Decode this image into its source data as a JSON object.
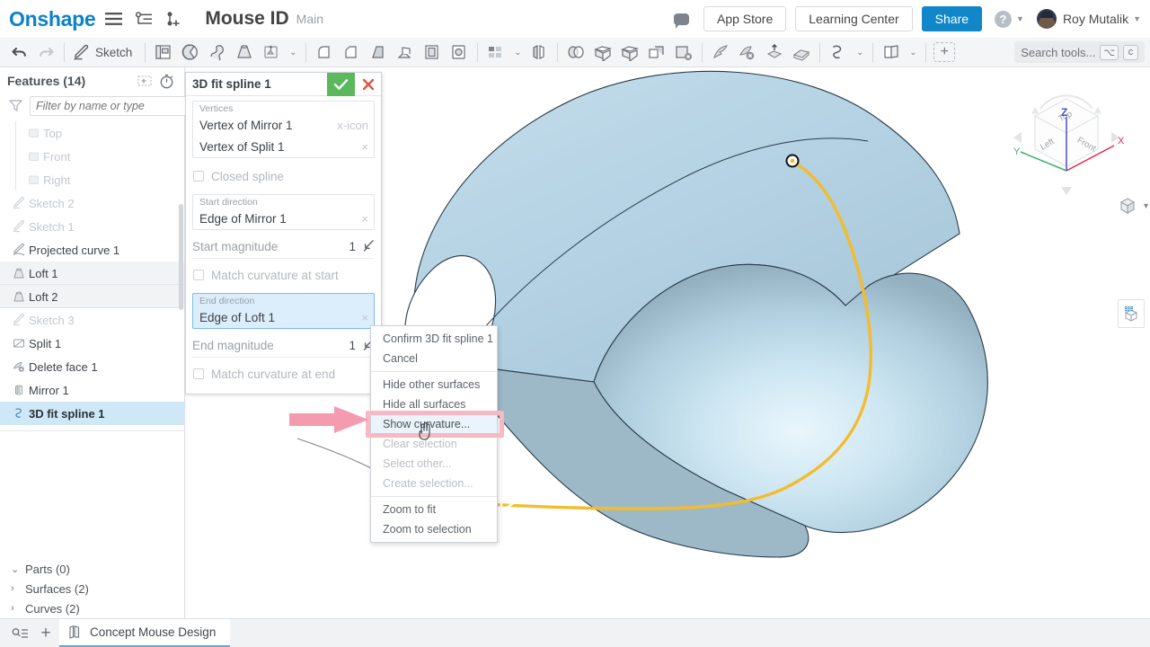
{
  "header": {
    "logo": "Onshape",
    "menu_icon": "hamburger-icon",
    "tree_icon": "document-tree-icon",
    "add_version_icon": "add-version-icon",
    "doc_title": "Mouse ID",
    "branch": "Main",
    "comment_icon": "comment-icon",
    "app_store": "App Store",
    "learning_center": "Learning Center",
    "share": "Share",
    "help_glyph": "?",
    "user_name": "Roy Mutalik",
    "accent_blue": "#0f87c9"
  },
  "toolbar": {
    "undo": "undo-icon",
    "redo": "redo-icon",
    "sketch_label": "Sketch",
    "search_placeholder": "Search tools...",
    "kbd_alt": "⌥",
    "kbd_c": "c",
    "items": [
      "extrude-icon",
      "revolve-icon",
      "sweep-icon",
      "loft-icon",
      "thicken-icon",
      "fillet-icon",
      "chamfer-icon",
      "draft-icon",
      "rib-icon",
      "shell-icon",
      "hole-icon",
      "linear-pattern-icon",
      "mirror-icon",
      "boolean-icon",
      "split-icon",
      "enclose-icon",
      "transform-icon",
      "delete-face-icon",
      "move-face-icon",
      "replace-face-icon",
      "delete-part-icon",
      "curve-icon",
      "plane-icon",
      "add-tool-icon"
    ]
  },
  "features_panel": {
    "title": "Features (14)",
    "add_folder_icon": "add-folder-icon",
    "rollback_icon": "history-timer-icon",
    "filter_icon": "funnel-icon",
    "filter_placeholder": "Filter by name or type",
    "items": [
      {
        "label": "Top",
        "icon": "plane-icon",
        "state": "plane"
      },
      {
        "label": "Front",
        "icon": "plane-icon",
        "state": "plane"
      },
      {
        "label": "Right",
        "icon": "plane-icon",
        "state": "plane"
      },
      {
        "label": "Sketch 2",
        "icon": "sketch-icon",
        "state": "dim"
      },
      {
        "label": "Sketch 1",
        "icon": "sketch-icon",
        "state": "dim"
      },
      {
        "label": "Projected curve 1",
        "icon": "projected-curve-icon",
        "state": "normal"
      },
      {
        "label": "Loft 1",
        "icon": "loft-icon",
        "state": "hl"
      },
      {
        "label": "Loft 2",
        "icon": "loft-icon",
        "state": "hl"
      },
      {
        "label": "Sketch 3",
        "icon": "sketch-icon",
        "state": "dim"
      },
      {
        "label": "Split 1",
        "icon": "split-icon",
        "state": "normal"
      },
      {
        "label": "Delete face 1",
        "icon": "delete-face-icon",
        "state": "normal"
      },
      {
        "label": "Mirror 1",
        "icon": "mirror-icon",
        "state": "normal"
      },
      {
        "label": "3D fit spline 1",
        "icon": "spline-icon",
        "state": "sel"
      }
    ],
    "sections": [
      {
        "label": "Parts (0)",
        "expanded": true,
        "chevron": "⌄"
      },
      {
        "label": "Surfaces (2)",
        "expanded": false,
        "chevron": "›"
      },
      {
        "label": "Curves (2)",
        "expanded": false,
        "chevron": "›"
      }
    ]
  },
  "dialog": {
    "title": "3D fit spline 1",
    "confirm_icon": "checkmark-icon",
    "cancel_icon": "x-icon",
    "vertices_label": "Vertices",
    "vertices": [
      "Vertex of Mirror 1",
      "Vertex of Split 1"
    ],
    "closed_spline": "Closed spline",
    "start_direction_label": "Start direction",
    "start_direction_value": "Edge of Mirror 1",
    "start_magnitude_label": "Start magnitude",
    "start_magnitude_value": "1",
    "match_curvature_start": "Match curvature at start",
    "end_direction_label": "End direction",
    "end_direction_value": "Edge of Loft 1",
    "end_magnitude_label": "End magnitude",
    "end_magnitude_value": "1",
    "match_curvature_end": "Match curvature at end",
    "flip_icon": "flip-direction-icon",
    "remove_icon": "x-icon",
    "active_field_highlight": "#dceefb"
  },
  "context_menu": {
    "highlight_color": "#f7b8c3",
    "items": [
      {
        "label": "Confirm 3D fit spline 1",
        "state": "normal"
      },
      {
        "label": "Cancel",
        "state": "normal"
      },
      {
        "sep": true
      },
      {
        "label": "Hide other surfaces",
        "state": "normal"
      },
      {
        "label": "Hide all surfaces",
        "state": "normal"
      },
      {
        "label": "Show curvature...",
        "state": "highlight"
      },
      {
        "label": "Clear selection",
        "state": "dim"
      },
      {
        "label": "Select other...",
        "state": "dim"
      },
      {
        "label": "Create selection...",
        "state": "dim"
      },
      {
        "sep": true
      },
      {
        "label": "Zoom to fit",
        "state": "normal"
      },
      {
        "label": "Zoom to selection",
        "state": "normal"
      }
    ]
  },
  "annotation": {
    "arrow_icon": "pink-pointer-arrow",
    "arrow_color": "#f49bb0",
    "cursor_icon": "hand-pointer-cursor"
  },
  "viewport": {
    "model_name": "concept-mouse-surface",
    "surface_fill_light": "#dff0fa",
    "surface_fill_mid": "#b7d4e6",
    "surface_fill_dark": "#92aebd",
    "selected_edge_color": "#f4bc2c",
    "viewcube": {
      "top_label": "Top",
      "left_label": "Left",
      "front_label": "Front",
      "axis_x": "X",
      "axis_y": "Y",
      "axis_z": "Z",
      "x_color": "#e0294a",
      "y_color": "#3eb36a",
      "z_color": "#4a4fd0"
    },
    "view_style_icon": "shaded-view-icon",
    "right_tool_icon": "render-grid-icon",
    "direction_arrow_icon": "spline-direction-arrow"
  },
  "bottom_bar": {
    "filter_icon": "element-filter-icon",
    "add_tab_icon": "add-tab-icon",
    "tab_icon": "part-studio-icon",
    "tab_label": "Concept Mouse Design",
    "tab_accent": "#6ba7d6"
  }
}
